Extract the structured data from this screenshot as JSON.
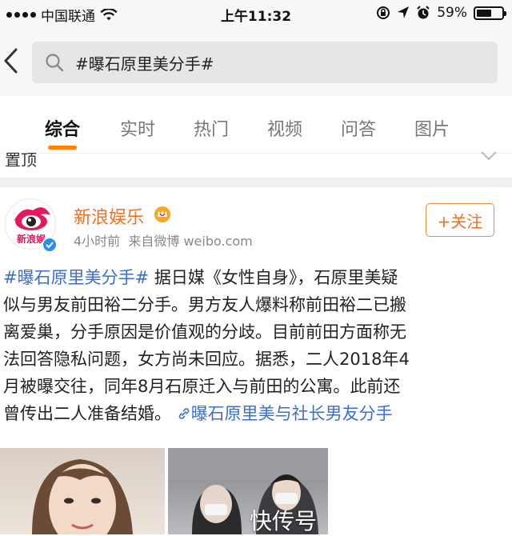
{
  "status_bar": {
    "carrier": "中国联通",
    "time": "上午11:32",
    "battery": "59%",
    "battery_level": 0.59
  },
  "search": {
    "query": "#曝石原里美分手#"
  },
  "tabs": [
    {
      "label": "综合",
      "active": true
    },
    {
      "label": "实时",
      "active": false
    },
    {
      "label": "热门",
      "active": false
    },
    {
      "label": "视频",
      "active": false
    },
    {
      "label": "问答",
      "active": false
    },
    {
      "label": "图片",
      "active": false
    }
  ],
  "pinned": {
    "label": "置顶"
  },
  "post": {
    "author": "新浪娱乐",
    "time": "4小时前",
    "source": "来自微博 weibo.com",
    "follow_label": "+关注",
    "hashtag": "#曝石原里美分手#",
    "lines": [
      " 据日媒《女性自身》，石原里美疑",
      "似与男友前田裕二分手。男方友人爆料称前田裕二已搬",
      "离爱巢，分手原因是价值观的分歧。目前前田方面称无",
      "法回答隐私问题，女方尚未回应。据悉，二人2018年4",
      "月被曝交往，同年8月石原迁入与前田的公寓。此前还",
      "曾传出二人准备结婚。"
    ],
    "link_text": "曝石原里美与社长男友分手",
    "avatar_text": "新浪娱",
    "watermark": "快传号"
  },
  "colors": {
    "accent": "#ff8200",
    "username": "#f36f21",
    "link": "#3b6ed1",
    "verified": "#2d8cf0"
  },
  "icons": [
    "signal-icon",
    "wifi-icon",
    "lock-rotation-icon",
    "location-icon",
    "alarm-icon",
    "battery-icon",
    "back-icon",
    "search-icon",
    "chevron-down-icon",
    "crown-icon",
    "verified-icon",
    "link-icon"
  ]
}
